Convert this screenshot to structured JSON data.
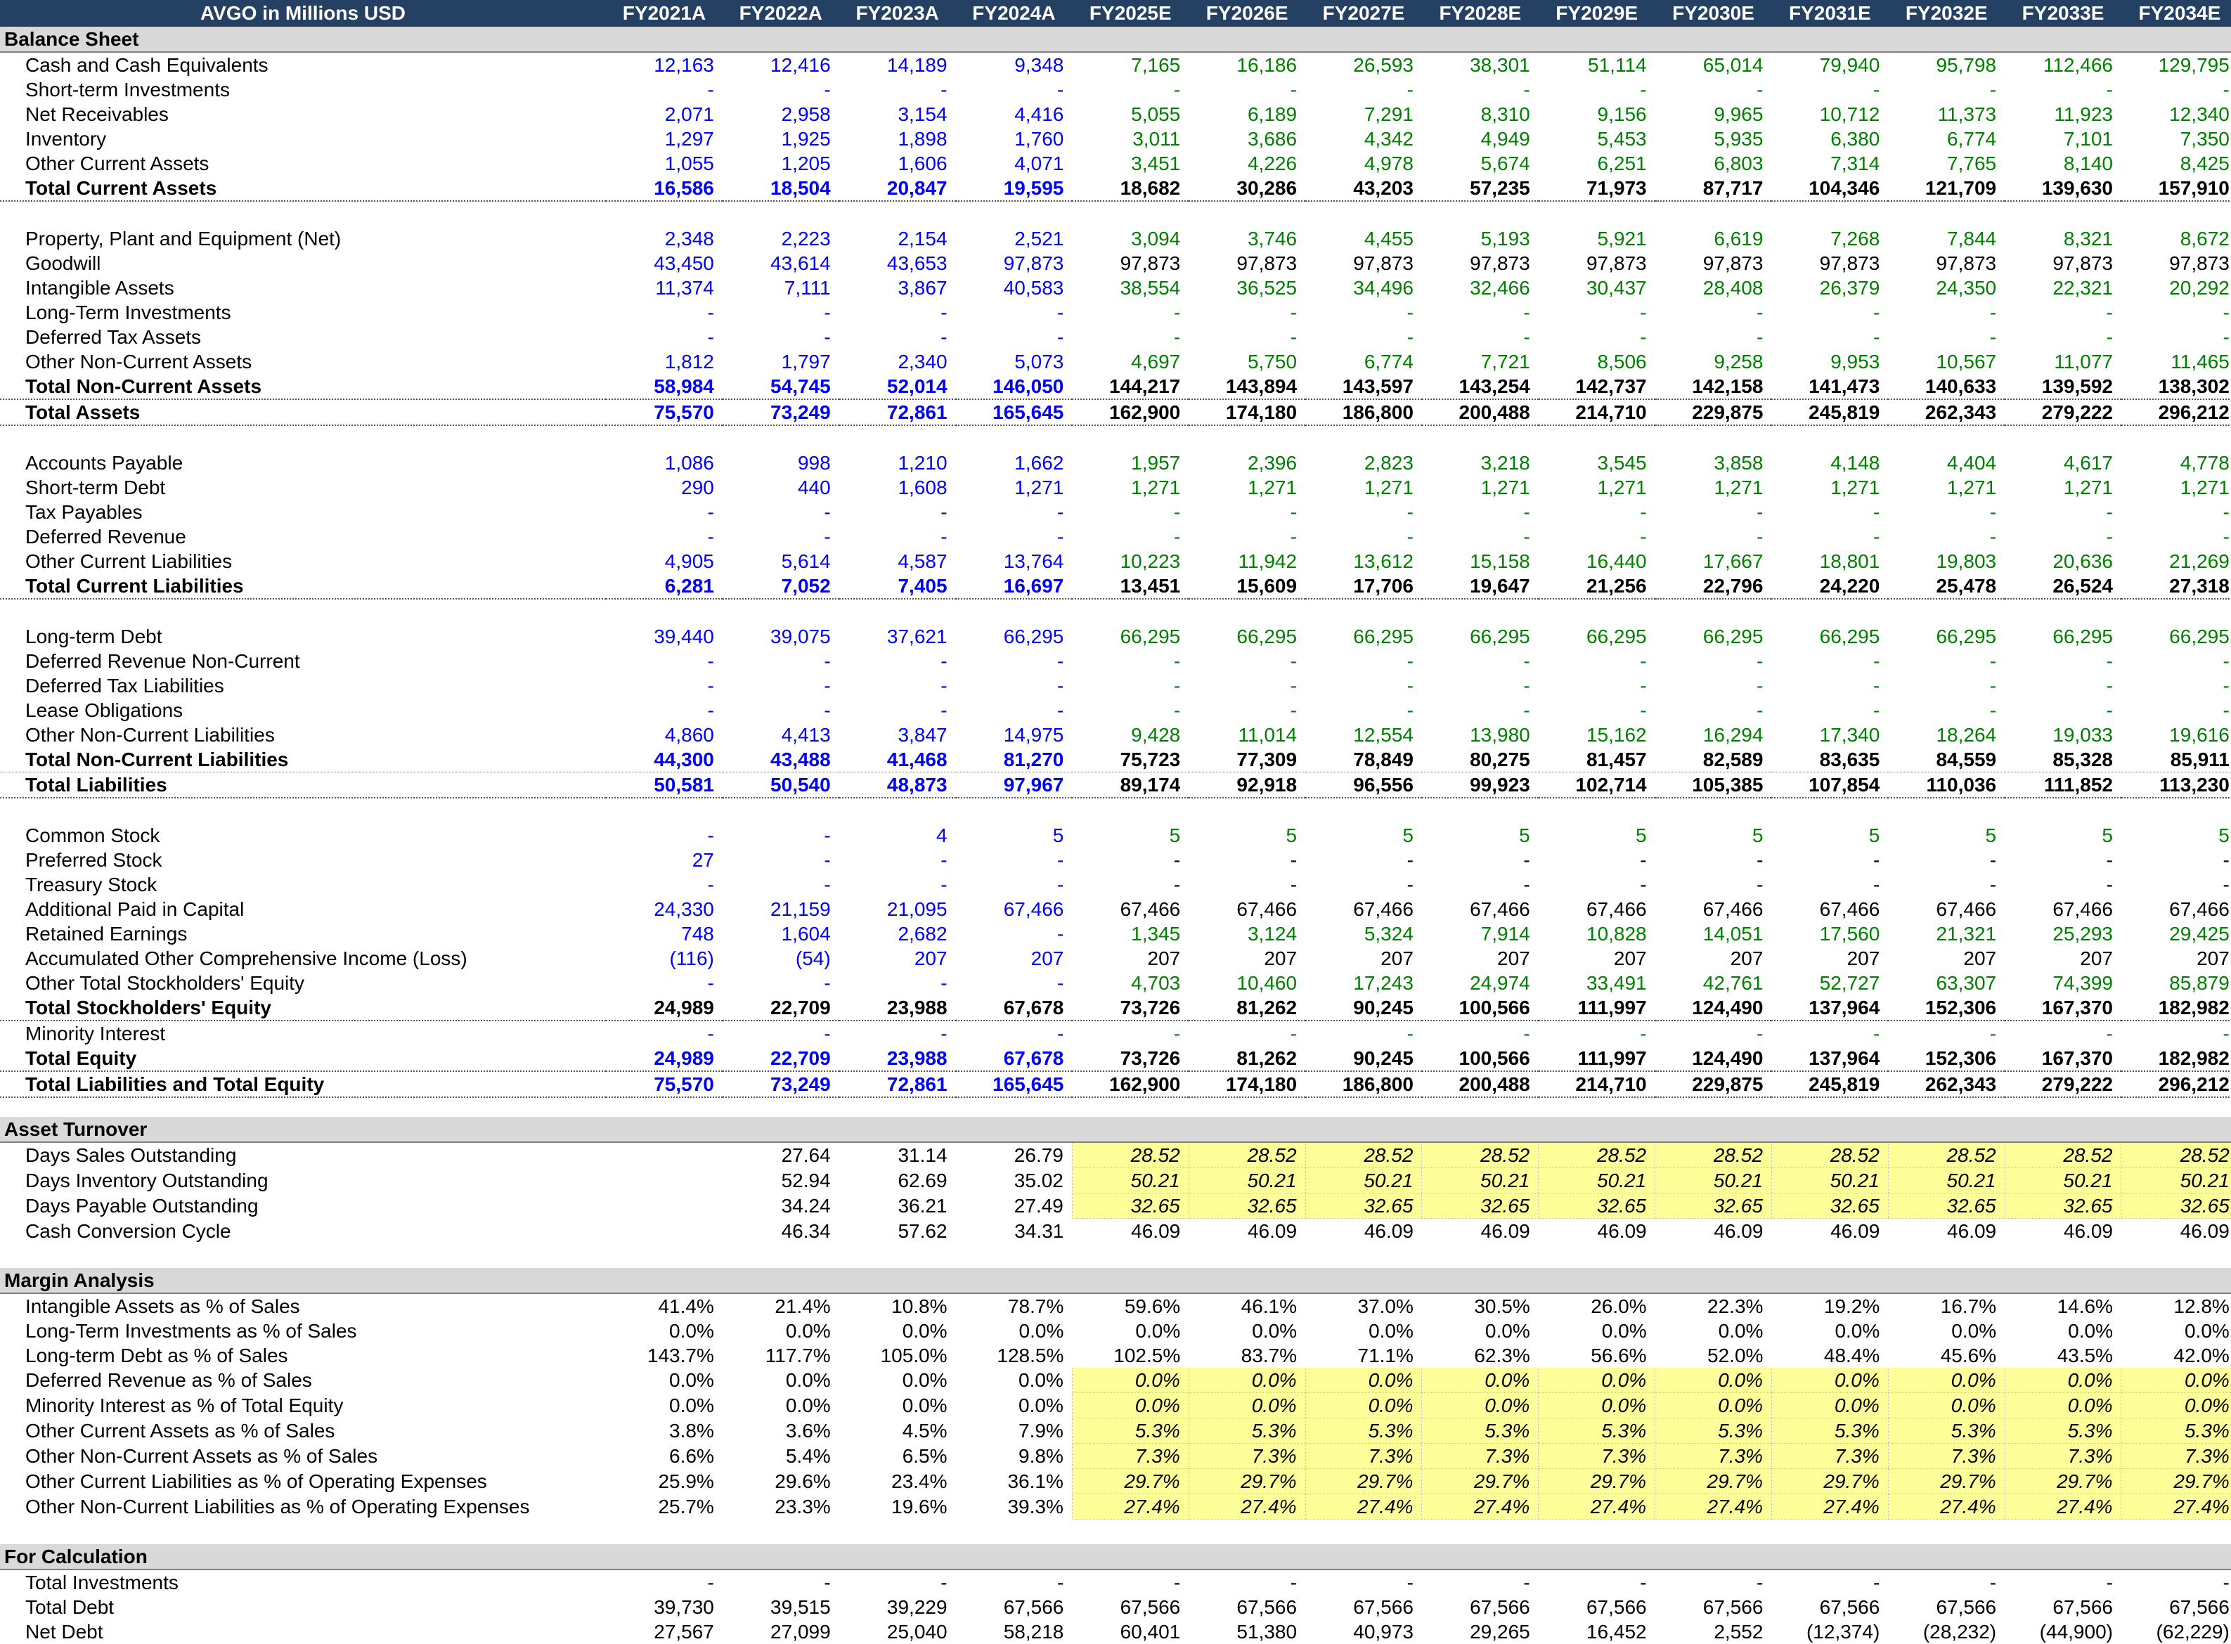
{
  "header": {
    "title": "AVGO in Millions USD",
    "years": [
      "FY2021A",
      "FY2022A",
      "FY2023A",
      "FY2024A",
      "FY2025E",
      "FY2026E",
      "FY2027E",
      "FY2028E",
      "FY2029E",
      "FY2030E",
      "FY2031E",
      "FY2032E",
      "FY2033E",
      "FY2034E"
    ]
  },
  "colors": {
    "header_bg": "#244062",
    "section_bg": "#d9d9d9",
    "historical": "#0000ff",
    "forecast": "#008000",
    "assumption_bg": "#ffff99"
  },
  "rows": [
    {
      "t": "section",
      "label": "Balance Sheet"
    },
    {
      "t": "row",
      "label": "Cash and Cash Equivalents",
      "v": [
        "12,163",
        "12,416",
        "14,189",
        "9,348",
        "7,165",
        "16,186",
        "26,593",
        "38,301",
        "51,114",
        "65,014",
        "79,940",
        "95,798",
        "112,466",
        "129,795"
      ]
    },
    {
      "t": "row",
      "label": "Short-term Investments",
      "v": [
        "-",
        "-",
        "-",
        "-",
        "-",
        "-",
        "-",
        "-",
        "-",
        "-",
        "-",
        "-",
        "-",
        "-"
      ]
    },
    {
      "t": "row",
      "label": "Net Receivables",
      "v": [
        "2,071",
        "2,958",
        "3,154",
        "4,416",
        "5,055",
        "6,189",
        "7,291",
        "8,310",
        "9,156",
        "9,965",
        "10,712",
        "11,373",
        "11,923",
        "12,340"
      ]
    },
    {
      "t": "row",
      "label": "Inventory",
      "v": [
        "1,297",
        "1,925",
        "1,898",
        "1,760",
        "3,011",
        "3,686",
        "4,342",
        "4,949",
        "5,453",
        "5,935",
        "6,380",
        "6,774",
        "7,101",
        "7,350"
      ]
    },
    {
      "t": "row",
      "label": "Other Current Assets",
      "v": [
        "1,055",
        "1,205",
        "1,606",
        "4,071",
        "3,451",
        "4,226",
        "4,978",
        "5,674",
        "6,251",
        "6,803",
        "7,314",
        "7,765",
        "8,140",
        "8,425"
      ]
    },
    {
      "t": "total",
      "label": "Total Current Assets",
      "v": [
        "16,586",
        "18,504",
        "20,847",
        "19,595",
        "18,682",
        "30,286",
        "43,203",
        "57,235",
        "71,973",
        "87,717",
        "104,346",
        "121,709",
        "139,630",
        "157,910"
      ]
    },
    {
      "t": "blank"
    },
    {
      "t": "row",
      "label": "Property, Plant and Equipment (Net)",
      "v": [
        "2,348",
        "2,223",
        "2,154",
        "2,521",
        "3,094",
        "3,746",
        "4,455",
        "5,193",
        "5,921",
        "6,619",
        "7,268",
        "7,844",
        "8,321",
        "8,672"
      ]
    },
    {
      "t": "row",
      "label": "Goodwill",
      "fcblack": true,
      "v": [
        "43,450",
        "43,614",
        "43,653",
        "97,873",
        "97,873",
        "97,873",
        "97,873",
        "97,873",
        "97,873",
        "97,873",
        "97,873",
        "97,873",
        "97,873",
        "97,873"
      ]
    },
    {
      "t": "row",
      "label": "Intangible Assets",
      "v": [
        "11,374",
        "7,111",
        "3,867",
        "40,583",
        "38,554",
        "36,525",
        "34,496",
        "32,466",
        "30,437",
        "28,408",
        "26,379",
        "24,350",
        "22,321",
        "20,292"
      ]
    },
    {
      "t": "row",
      "label": "Long-Term Investments",
      "v": [
        "-",
        "-",
        "-",
        "-",
        "-",
        "-",
        "-",
        "-",
        "-",
        "-",
        "-",
        "-",
        "-",
        "-"
      ]
    },
    {
      "t": "row",
      "label": "Deferred Tax Assets",
      "v": [
        "-",
        "-",
        "-",
        "-",
        "-",
        "-",
        "-",
        "-",
        "-",
        "-",
        "-",
        "-",
        "-",
        "-"
      ]
    },
    {
      "t": "row",
      "label": "Other Non-Current Assets",
      "v": [
        "1,812",
        "1,797",
        "2,340",
        "5,073",
        "4,697",
        "5,750",
        "6,774",
        "7,721",
        "8,506",
        "9,258",
        "9,953",
        "10,567",
        "11,077",
        "11,465"
      ]
    },
    {
      "t": "total",
      "label": "Total Non-Current Assets",
      "v": [
        "58,984",
        "54,745",
        "52,014",
        "146,050",
        "144,217",
        "143,894",
        "143,597",
        "143,254",
        "142,737",
        "142,158",
        "141,473",
        "140,633",
        "139,592",
        "138,302"
      ]
    },
    {
      "t": "total",
      "label": "Total Assets",
      "v": [
        "75,570",
        "73,249",
        "72,861",
        "165,645",
        "162,900",
        "174,180",
        "186,800",
        "200,488",
        "214,710",
        "229,875",
        "245,819",
        "262,343",
        "279,222",
        "296,212"
      ]
    },
    {
      "t": "blank"
    },
    {
      "t": "row",
      "label": "Accounts Payable",
      "v": [
        "1,086",
        "998",
        "1,210",
        "1,662",
        "1,957",
        "2,396",
        "2,823",
        "3,218",
        "3,545",
        "3,858",
        "4,148",
        "4,404",
        "4,617",
        "4,778"
      ]
    },
    {
      "t": "row",
      "label": "Short-term Debt",
      "v": [
        "290",
        "440",
        "1,608",
        "1,271",
        "1,271",
        "1,271",
        "1,271",
        "1,271",
        "1,271",
        "1,271",
        "1,271",
        "1,271",
        "1,271",
        "1,271"
      ]
    },
    {
      "t": "row",
      "label": "Tax Payables",
      "v": [
        "-",
        "-",
        "-",
        "-",
        "-",
        "-",
        "-",
        "-",
        "-",
        "-",
        "-",
        "-",
        "-",
        "-"
      ]
    },
    {
      "t": "row",
      "label": "Deferred Revenue",
      "v": [
        "-",
        "-",
        "-",
        "-",
        "-",
        "-",
        "-",
        "-",
        "-",
        "-",
        "-",
        "-",
        "-",
        "-"
      ]
    },
    {
      "t": "row",
      "label": "Other Current Liabilities",
      "v": [
        "4,905",
        "5,614",
        "4,587",
        "13,764",
        "10,223",
        "11,942",
        "13,612",
        "15,158",
        "16,440",
        "17,667",
        "18,801",
        "19,803",
        "20,636",
        "21,269"
      ]
    },
    {
      "t": "total",
      "label": "Total Current Liabilities",
      "v": [
        "6,281",
        "7,052",
        "7,405",
        "16,697",
        "13,451",
        "15,609",
        "17,706",
        "19,647",
        "21,256",
        "22,796",
        "24,220",
        "25,478",
        "26,524",
        "27,318"
      ]
    },
    {
      "t": "blank"
    },
    {
      "t": "row",
      "label": "Long-term Debt",
      "v": [
        "39,440",
        "39,075",
        "37,621",
        "66,295",
        "66,295",
        "66,295",
        "66,295",
        "66,295",
        "66,295",
        "66,295",
        "66,295",
        "66,295",
        "66,295",
        "66,295"
      ]
    },
    {
      "t": "row",
      "label": "Deferred Revenue Non-Current",
      "v": [
        "-",
        "-",
        "-",
        "-",
        "-",
        "-",
        "-",
        "-",
        "-",
        "-",
        "-",
        "-",
        "-",
        "-"
      ]
    },
    {
      "t": "row",
      "label": "Deferred Tax Liabilities",
      "v": [
        "-",
        "-",
        "-",
        "-",
        "-",
        "-",
        "-",
        "-",
        "-",
        "-",
        "-",
        "-",
        "-",
        "-"
      ]
    },
    {
      "t": "row",
      "label": "Lease Obligations",
      "v": [
        "-",
        "-",
        "-",
        "-",
        "-",
        "-",
        "-",
        "-",
        "-",
        "-",
        "-",
        "-",
        "-",
        "-"
      ]
    },
    {
      "t": "row",
      "label": "Other Non-Current Liabilities",
      "v": [
        "4,860",
        "4,413",
        "3,847",
        "14,975",
        "9,428",
        "11,014",
        "12,554",
        "13,980",
        "15,162",
        "16,294",
        "17,340",
        "18,264",
        "19,033",
        "19,616"
      ]
    },
    {
      "t": "totalnb",
      "label": "Total Non-Current Liabilities",
      "v": [
        "44,300",
        "43,488",
        "41,468",
        "81,270",
        "75,723",
        "77,309",
        "78,849",
        "80,275",
        "81,457",
        "82,589",
        "83,635",
        "84,559",
        "85,328",
        "85,911"
      ]
    },
    {
      "t": "total",
      "label": "Total Liabilities",
      "v": [
        "50,581",
        "50,540",
        "48,873",
        "97,967",
        "89,174",
        "92,918",
        "96,556",
        "99,923",
        "102,714",
        "105,385",
        "107,854",
        "110,036",
        "111,852",
        "113,230"
      ]
    },
    {
      "t": "blank"
    },
    {
      "t": "row",
      "label": "Common Stock",
      "v": [
        "-",
        "-",
        "4",
        "5",
        "5",
        "5",
        "5",
        "5",
        "5",
        "5",
        "5",
        "5",
        "5",
        "5"
      ]
    },
    {
      "t": "row",
      "label": "Preferred Stock",
      "fcblack": true,
      "v": [
        "27",
        "-",
        "-",
        "-",
        "-",
        "-",
        "-",
        "-",
        "-",
        "-",
        "-",
        "-",
        "-",
        "-"
      ]
    },
    {
      "t": "row",
      "label": "Treasury Stock",
      "fcblack": true,
      "v": [
        "-",
        "-",
        "-",
        "-",
        "-",
        "-",
        "-",
        "-",
        "-",
        "-",
        "-",
        "-",
        "-",
        "-"
      ]
    },
    {
      "t": "row",
      "label": "Additional Paid in Capital",
      "fcblack": true,
      "v": [
        "24,330",
        "21,159",
        "21,095",
        "67,466",
        "67,466",
        "67,466",
        "67,466",
        "67,466",
        "67,466",
        "67,466",
        "67,466",
        "67,466",
        "67,466",
        "67,466"
      ]
    },
    {
      "t": "row",
      "label": "Retained Earnings",
      "v": [
        "748",
        "1,604",
        "2,682",
        "-",
        "1,345",
        "3,124",
        "5,324",
        "7,914",
        "10,828",
        "14,051",
        "17,560",
        "21,321",
        "25,293",
        "29,425"
      ]
    },
    {
      "t": "row",
      "label": "Accumulated Other Comprehensive Income (Loss)",
      "fcblack": true,
      "v": [
        "(116)",
        "(54)",
        "207",
        "207",
        "207",
        "207",
        "207",
        "207",
        "207",
        "207",
        "207",
        "207",
        "207",
        "207"
      ]
    },
    {
      "t": "row",
      "label": "Other Total Stockholders' Equity",
      "v": [
        "-",
        "-",
        "-",
        "-",
        "4,703",
        "10,460",
        "17,243",
        "24,974",
        "33,491",
        "42,761",
        "52,727",
        "63,307",
        "74,399",
        "85,879"
      ]
    },
    {
      "t": "totalblack",
      "label": "Total Stockholders' Equity",
      "v": [
        "24,989",
        "22,709",
        "23,988",
        "67,678",
        "73,726",
        "81,262",
        "90,245",
        "100,566",
        "111,997",
        "124,490",
        "137,964",
        "152,306",
        "167,370",
        "182,982"
      ]
    },
    {
      "t": "row",
      "label": "Minority Interest",
      "v": [
        "-",
        "-",
        "-",
        "-",
        "-",
        "-",
        "-",
        "-",
        "-",
        "-",
        "-",
        "-",
        "-",
        "-"
      ]
    },
    {
      "t": "total",
      "label": "Total Equity",
      "v": [
        "24,989",
        "22,709",
        "23,988",
        "67,678",
        "73,726",
        "81,262",
        "90,245",
        "100,566",
        "111,997",
        "124,490",
        "137,964",
        "152,306",
        "167,370",
        "182,982"
      ]
    },
    {
      "t": "total",
      "label": "Total Liabilities and Total Equity",
      "v": [
        "75,570",
        "73,249",
        "72,861",
        "165,645",
        "162,900",
        "174,180",
        "186,800",
        "200,488",
        "214,710",
        "229,875",
        "245,819",
        "262,343",
        "279,222",
        "296,212"
      ]
    },
    {
      "t": "gap"
    },
    {
      "t": "section",
      "label": "Asset Turnover"
    },
    {
      "t": "ratio",
      "label": "Days Sales Outstanding",
      "yel": true,
      "v": [
        "",
        "27.64",
        "31.14",
        "26.79",
        "28.52",
        "28.52",
        "28.52",
        "28.52",
        "28.52",
        "28.52",
        "28.52",
        "28.52",
        "28.52",
        "28.52"
      ]
    },
    {
      "t": "ratio",
      "label": "Days Inventory Outstanding",
      "yel": true,
      "v": [
        "",
        "52.94",
        "62.69",
        "35.02",
        "50.21",
        "50.21",
        "50.21",
        "50.21",
        "50.21",
        "50.21",
        "50.21",
        "50.21",
        "50.21",
        "50.21"
      ]
    },
    {
      "t": "ratio",
      "label": "Days Payable Outstanding",
      "yel": true,
      "v": [
        "",
        "34.24",
        "36.21",
        "27.49",
        "32.65",
        "32.65",
        "32.65",
        "32.65",
        "32.65",
        "32.65",
        "32.65",
        "32.65",
        "32.65",
        "32.65"
      ]
    },
    {
      "t": "ratio",
      "label": "Cash Conversion Cycle",
      "v": [
        "",
        "46.34",
        "57.62",
        "34.31",
        "46.09",
        "46.09",
        "46.09",
        "46.09",
        "46.09",
        "46.09",
        "46.09",
        "46.09",
        "46.09",
        "46.09"
      ]
    },
    {
      "t": "blank"
    },
    {
      "t": "section",
      "label": "Margin Analysis"
    },
    {
      "t": "ratio",
      "label": "Intangible Assets as % of Sales",
      "v": [
        "41.4%",
        "21.4%",
        "10.8%",
        "78.7%",
        "59.6%",
        "46.1%",
        "37.0%",
        "30.5%",
        "26.0%",
        "22.3%",
        "19.2%",
        "16.7%",
        "14.6%",
        "12.8%"
      ]
    },
    {
      "t": "ratio",
      "label": "Long-Term Investments as % of Sales",
      "v": [
        "0.0%",
        "0.0%",
        "0.0%",
        "0.0%",
        "0.0%",
        "0.0%",
        "0.0%",
        "0.0%",
        "0.0%",
        "0.0%",
        "0.0%",
        "0.0%",
        "0.0%",
        "0.0%"
      ]
    },
    {
      "t": "ratio",
      "label": "Long-term Debt as % of Sales",
      "v": [
        "143.7%",
        "117.7%",
        "105.0%",
        "128.5%",
        "102.5%",
        "83.7%",
        "71.1%",
        "62.3%",
        "56.6%",
        "52.0%",
        "48.4%",
        "45.6%",
        "43.5%",
        "42.0%"
      ]
    },
    {
      "t": "ratio",
      "label": "Deferred Revenue as % of Sales",
      "yel": true,
      "v": [
        "0.0%",
        "0.0%",
        "0.0%",
        "0.0%",
        "0.0%",
        "0.0%",
        "0.0%",
        "0.0%",
        "0.0%",
        "0.0%",
        "0.0%",
        "0.0%",
        "0.0%",
        "0.0%"
      ]
    },
    {
      "t": "ratio",
      "label": "Minority Interest as % of Total Equity",
      "yel": true,
      "v": [
        "0.0%",
        "0.0%",
        "0.0%",
        "0.0%",
        "0.0%",
        "0.0%",
        "0.0%",
        "0.0%",
        "0.0%",
        "0.0%",
        "0.0%",
        "0.0%",
        "0.0%",
        "0.0%"
      ]
    },
    {
      "t": "ratio",
      "label": "Other Current Assets as % of Sales",
      "yel": true,
      "v": [
        "3.8%",
        "3.6%",
        "4.5%",
        "7.9%",
        "5.3%",
        "5.3%",
        "5.3%",
        "5.3%",
        "5.3%",
        "5.3%",
        "5.3%",
        "5.3%",
        "5.3%",
        "5.3%"
      ]
    },
    {
      "t": "ratio",
      "label": "Other Non-Current Assets as % of Sales",
      "yel": true,
      "v": [
        "6.6%",
        "5.4%",
        "6.5%",
        "9.8%",
        "7.3%",
        "7.3%",
        "7.3%",
        "7.3%",
        "7.3%",
        "7.3%",
        "7.3%",
        "7.3%",
        "7.3%",
        "7.3%"
      ]
    },
    {
      "t": "ratio",
      "label": "Other Current Liabilities as % of Operating Expenses",
      "yel": true,
      "v": [
        "25.9%",
        "29.6%",
        "23.4%",
        "36.1%",
        "29.7%",
        "29.7%",
        "29.7%",
        "29.7%",
        "29.7%",
        "29.7%",
        "29.7%",
        "29.7%",
        "29.7%",
        "29.7%"
      ]
    },
    {
      "t": "ratio",
      "label": "Other Non-Current Liabilities as % of Operating Expenses",
      "yel": true,
      "v": [
        "25.7%",
        "23.3%",
        "19.6%",
        "39.3%",
        "27.4%",
        "27.4%",
        "27.4%",
        "27.4%",
        "27.4%",
        "27.4%",
        "27.4%",
        "27.4%",
        "27.4%",
        "27.4%"
      ]
    },
    {
      "t": "blank"
    },
    {
      "t": "section",
      "label": "For Calculation"
    },
    {
      "t": "ratio",
      "label": "Total Investments",
      "v": [
        "-",
        "-",
        "-",
        "-",
        "-",
        "-",
        "-",
        "-",
        "-",
        "-",
        "-",
        "-",
        "-",
        "-"
      ]
    },
    {
      "t": "ratio",
      "label": "Total Debt",
      "v": [
        "39,730",
        "39,515",
        "39,229",
        "67,566",
        "67,566",
        "67,566",
        "67,566",
        "67,566",
        "67,566",
        "67,566",
        "67,566",
        "67,566",
        "67,566",
        "67,566"
      ]
    },
    {
      "t": "ratio",
      "label": "Net Debt",
      "v": [
        "27,567",
        "27,099",
        "25,040",
        "58,218",
        "60,401",
        "51,380",
        "40,973",
        "29,265",
        "16,452",
        "2,552",
        "(12,374)",
        "(28,232)",
        "(44,900)",
        "(62,229)"
      ]
    }
  ]
}
